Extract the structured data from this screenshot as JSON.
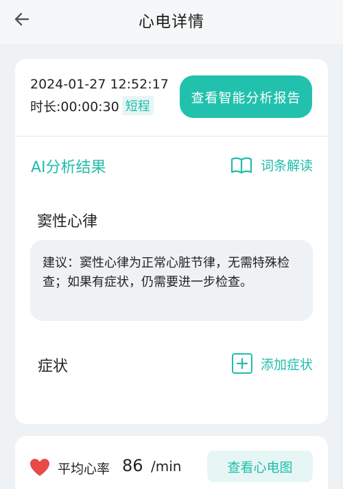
{
  "header": {
    "title": "心电详情"
  },
  "record": {
    "datetime": "2024-01-27 12:52:17",
    "duration_label": "时长:00:00:30",
    "duration_tag": "短程",
    "report_button": "查看智能分析报告"
  },
  "analysis": {
    "section_title": "AI分析结果",
    "glossary_link": "词条解读",
    "diagnosis": "窦性心律",
    "advice": "建议：窦性心律为正常心脏节律，无需特殊检查；如果有症状，仍需要进一步检查。"
  },
  "symptoms": {
    "label": "症状",
    "add_button": "添加症状"
  },
  "heart_rate": {
    "label": "平均心率",
    "value": "86",
    "unit": "/min",
    "view_ecg_button": "查看心电图"
  },
  "colors": {
    "accent": "#22c1ad",
    "accent_text": "#1ebdaa",
    "heart": "#e84a4a"
  }
}
